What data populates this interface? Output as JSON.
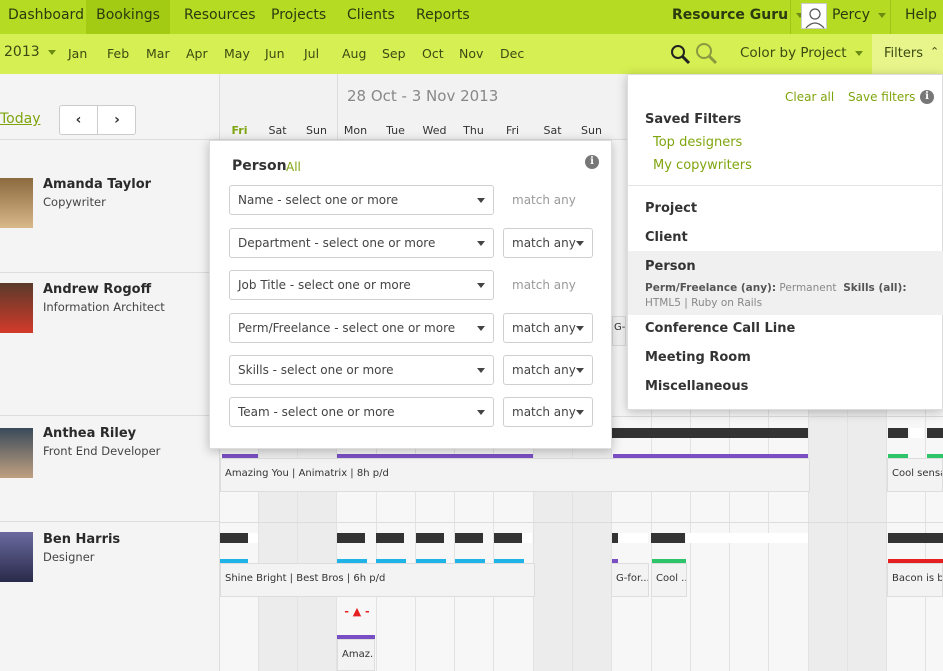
{
  "nav": {
    "dashboard": "Dashboard",
    "bookings": "Bookings",
    "resources": "Resources",
    "projects": "Projects",
    "clients": "Clients",
    "reports": "Reports",
    "account": "Resource Guru",
    "user": "Percy",
    "help": "Help"
  },
  "subnav": {
    "year": "2013",
    "months": [
      "Jan",
      "Feb",
      "Mar",
      "Apr",
      "May",
      "Jun",
      "Jul",
      "Aug",
      "Sep",
      "Oct",
      "Nov",
      "Dec"
    ],
    "color_by": "Color by Project",
    "filters": "Filters"
  },
  "calendar": {
    "today": "Today",
    "range": "28 Oct - 3 Nov 2013",
    "days": [
      "Fri",
      "Sat",
      "Sun",
      "Mon",
      "Tue",
      "Wed",
      "Thu",
      "Fri",
      "Sat",
      "Sun"
    ]
  },
  "people": [
    {
      "name": "Amanda Taylor",
      "role": "Copywriter"
    },
    {
      "name": "Andrew Rogoff",
      "role": "Information Architect"
    },
    {
      "name": "Anthea Riley",
      "role": "Front End Developer"
    },
    {
      "name": "Ben Harris",
      "role": "Designer"
    }
  ],
  "bookings": {
    "anthea_main": "Amazing You | Animatrix | 8h p/d",
    "anthea_right": "Cool sensation",
    "ben_main": "Shine Bright | Best Bros | 6h p/d",
    "ben_g": "G-for...",
    "ben_cool": "Cool ...",
    "ben_right": "Bacon is best",
    "ben_amaz": "Amaz...",
    "andrew_g": "G-"
  },
  "person_filter": {
    "title": "Person",
    "all": "All",
    "rows": [
      {
        "label": "Name - select one or more",
        "match": "match any",
        "dropdown": false
      },
      {
        "label": "Department - select one or more",
        "match": "match any",
        "dropdown": true
      },
      {
        "label": "Job Title - select one or more",
        "match": "match any",
        "dropdown": false
      },
      {
        "label": "Perm/Freelance - select one or more",
        "match": "match any",
        "dropdown": true
      },
      {
        "label": "Skills - select one or more",
        "match": "match any",
        "dropdown": true
      },
      {
        "label": "Team - select one or more",
        "match": "match any",
        "dropdown": true
      }
    ]
  },
  "filters_panel": {
    "clear_all": "Clear all",
    "save_filters": "Save filters",
    "saved_title": "Saved Filters",
    "saved": [
      "Top designers",
      "My copywriters"
    ],
    "project": "Project",
    "client": "Client",
    "person": "Person",
    "person_summary": {
      "perm_label": "Perm/Freelance (any):",
      "perm_value": "Permanent",
      "skills_label": "Skills (all):",
      "skills_value": "HTML5",
      "sep": "|",
      "skills_value2": "Ruby on Rails"
    },
    "conference": "Conference Call Line",
    "meeting": "Meeting Room",
    "misc": "Miscellaneous"
  },
  "colors": {
    "nav_green": "#b5dc22",
    "subnav_green": "#d6ef52",
    "purple": "#7a4fc4",
    "blue": "#1fb3e8",
    "green": "#2ec46a",
    "red": "#e62020"
  }
}
